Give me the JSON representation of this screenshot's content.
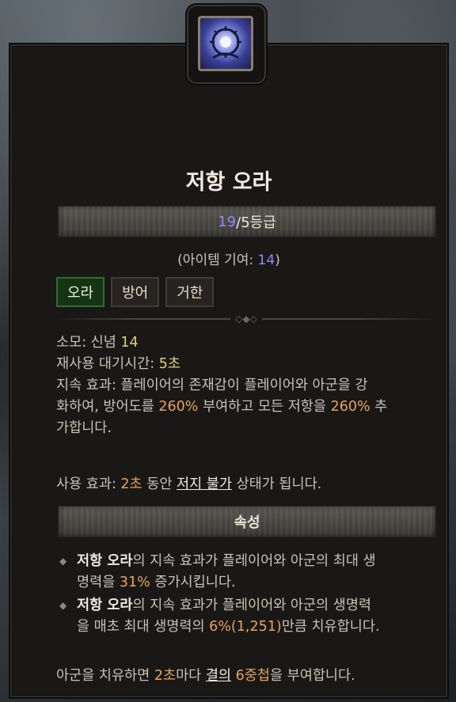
{
  "skill": {
    "name": "저항 오라",
    "icon": "resistance-aura-icon",
    "rank_current": "19",
    "rank_suffix": "/5등급",
    "contribution_prefix": "(아이템 기여: ",
    "contribution_value": "14",
    "contribution_suffix": ")"
  },
  "tags": [
    "오라",
    "방어",
    "거한"
  ],
  "details": {
    "cost_label": "소모: 신념 ",
    "cost_value": "14",
    "cooldown_label": "재사용 대기시간: ",
    "cooldown_value": "5초",
    "passive_line1_a": "지속 효과: 플레이어의 존재감이 플레이어와 아군을 강",
    "passive_line2_a": "화하여, 방어도를 ",
    "passive_pct1": "260%",
    "passive_line2_b": " 부여하고 모든 저항을 ",
    "passive_pct2": "260%",
    "passive_line2_c": " 추",
    "passive_line3": "가합니다.",
    "use_label": "사용 효과: ",
    "use_value": "2초",
    "use_mid": " 동안 ",
    "use_keyword": "저지 불가",
    "use_end": " 상태가 됩니다."
  },
  "attributes": {
    "header": "속성",
    "bullet1_name": "저항 오라",
    "bullet1_line1": "의 지속 효과가 플레이어와 아군의 최대 생",
    "bullet1_line2a": "명력을 ",
    "bullet1_pct": "31%",
    "bullet1_line2b": " 증가시킵니다.",
    "bullet2_name": "저항 오라",
    "bullet2_line1": "의 지속 효과가 플레이어와 아군의 생명력",
    "bullet2_line2a": "을 매초 최대 생명력의 ",
    "bullet2_pct": "6%(1,251)",
    "bullet2_line2b": "만큼 치유합니다."
  },
  "footer": {
    "a": "아군을 치유하면 ",
    "b": "2초",
    "c": "마다 ",
    "keyword": "결의",
    "d": " ",
    "e": "6중첩",
    "f": "을 부여합니다."
  },
  "colors": {
    "number_blue": "#8a8dff",
    "number_orange": "#e6a45c",
    "active_tag": "#163315"
  }
}
